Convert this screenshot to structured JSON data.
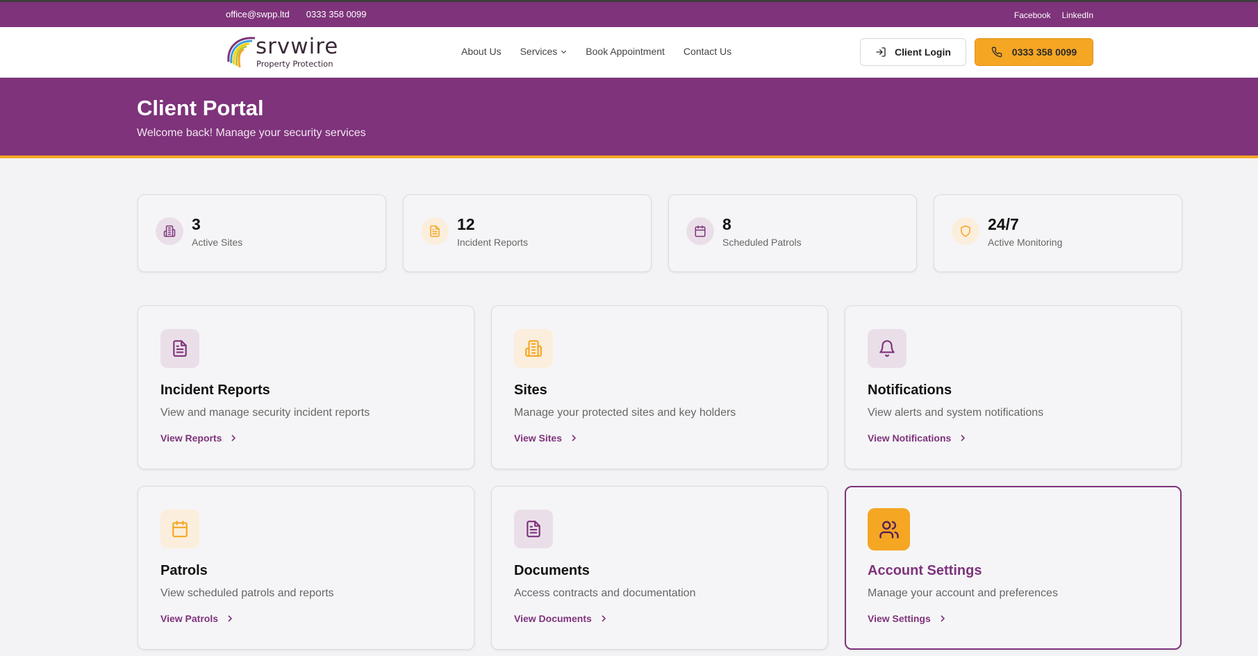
{
  "topbar": {
    "email": "office@swpp.ltd",
    "phone": "0333 358 0099",
    "social": [
      "Facebook",
      "LinkedIn"
    ]
  },
  "brand": {
    "name": "srvwire",
    "tagline": "Property Protection",
    "colors": {
      "primary": "#7e337b",
      "accent": "#f5a623"
    }
  },
  "nav": {
    "items": [
      {
        "label": "About Us",
        "has_dropdown": false
      },
      {
        "label": "Services",
        "has_dropdown": true
      },
      {
        "label": "Book Appointment",
        "has_dropdown": false
      },
      {
        "label": "Contact Us",
        "has_dropdown": false
      }
    ],
    "login_label": "Client Login",
    "phone_label": "0333 358 0099"
  },
  "hero": {
    "title": "Client Portal",
    "subtitle": "Welcome back! Manage your security services"
  },
  "stats": [
    {
      "value": "3",
      "label": "Active Sites",
      "icon": "building-icon"
    },
    {
      "value": "12",
      "label": "Incident Reports",
      "icon": "document-icon"
    },
    {
      "value": "8",
      "label": "Scheduled Patrols",
      "icon": "calendar-icon"
    },
    {
      "value": "24/7",
      "label": "Active Monitoring",
      "icon": "shield-icon"
    }
  ],
  "cards": [
    {
      "title": "Incident Reports",
      "description": "View and manage security incident reports",
      "link": "View Reports",
      "icon": "document-icon"
    },
    {
      "title": "Sites",
      "description": "Manage your protected sites and key holders",
      "link": "View Sites",
      "icon": "building-icon"
    },
    {
      "title": "Notifications",
      "description": "View alerts and system notifications",
      "link": "View Notifications",
      "icon": "bell-icon"
    },
    {
      "title": "Patrols",
      "description": "View scheduled patrols and reports",
      "link": "View Patrols",
      "icon": "calendar-icon"
    },
    {
      "title": "Documents",
      "description": "Access contracts and documentation",
      "link": "View Documents",
      "icon": "document-icon"
    },
    {
      "title": "Account Settings",
      "description": "Manage your account and preferences",
      "link": "View Settings",
      "icon": "users-icon",
      "active": true
    }
  ]
}
